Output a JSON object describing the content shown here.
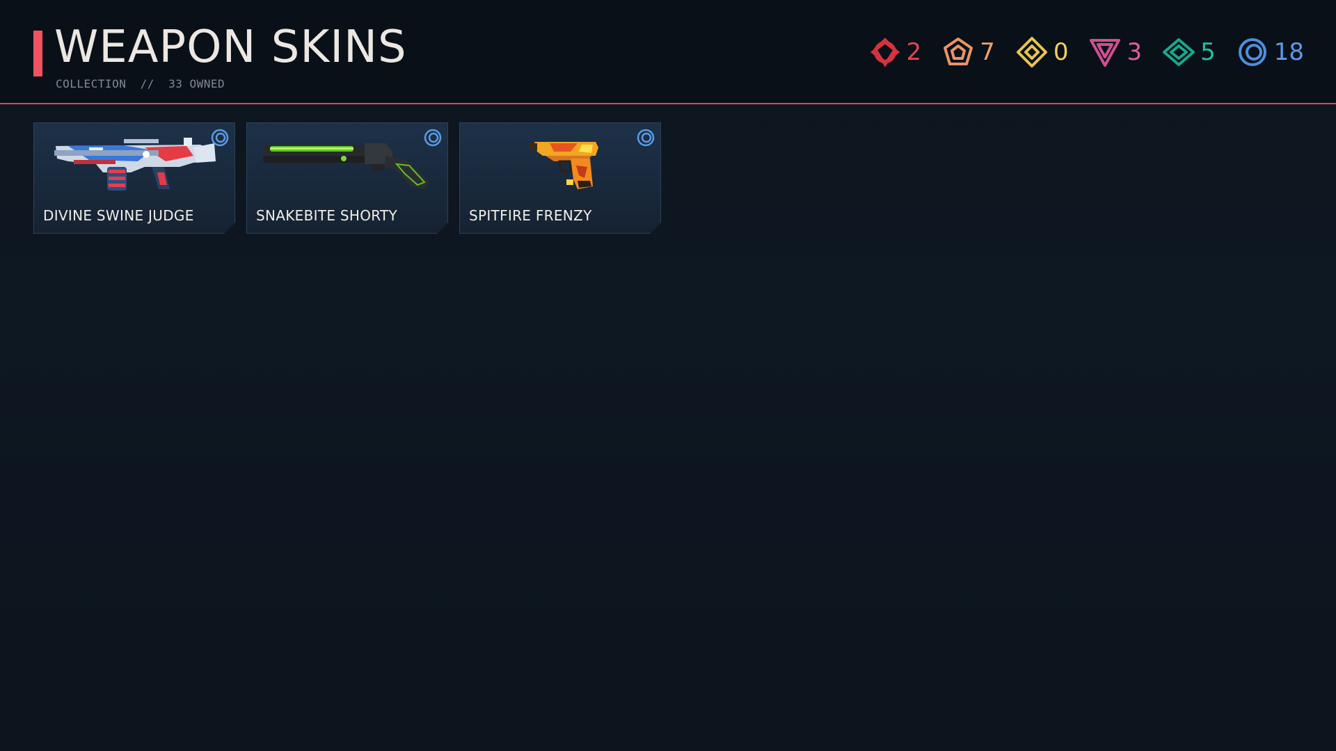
{
  "page": {
    "title": "WEAPON SKINS",
    "subtitle": "COLLECTION  //  33 OWNED"
  },
  "currencies": [
    {
      "icon": "red-knot-icon",
      "count": "2",
      "color": "#e8434d"
    },
    {
      "icon": "orange-pentagon-icon",
      "count": "7",
      "color": "#f0a46a"
    },
    {
      "icon": "gold-diamond-icon",
      "count": "0",
      "color": "#f2d25a"
    },
    {
      "icon": "pink-triangle-icon",
      "count": "3",
      "color": "#e25c9d"
    },
    {
      "icon": "teal-rhombus-icon",
      "count": "5",
      "color": "#1fc1a3"
    },
    {
      "icon": "blue-ring-icon",
      "count": "18",
      "color": "#5a9ae8"
    }
  ],
  "skins": [
    {
      "name": "DIVINE SWINE JUDGE",
      "weapon_icon": "judge-shotgun-icon",
      "rarity_icon": "blue-ring-icon"
    },
    {
      "name": "SNAKEBITE SHORTY",
      "weapon_icon": "shorty-shotgun-icon",
      "rarity_icon": "blue-ring-icon"
    },
    {
      "name": "SPITFIRE FRENZY",
      "weapon_icon": "frenzy-pistol-icon",
      "rarity_icon": "blue-ring-icon"
    }
  ],
  "colors": {
    "accent": "#f05262",
    "header_divider": "#e0464f",
    "background": "#0d141d",
    "card": "#1d3148"
  }
}
